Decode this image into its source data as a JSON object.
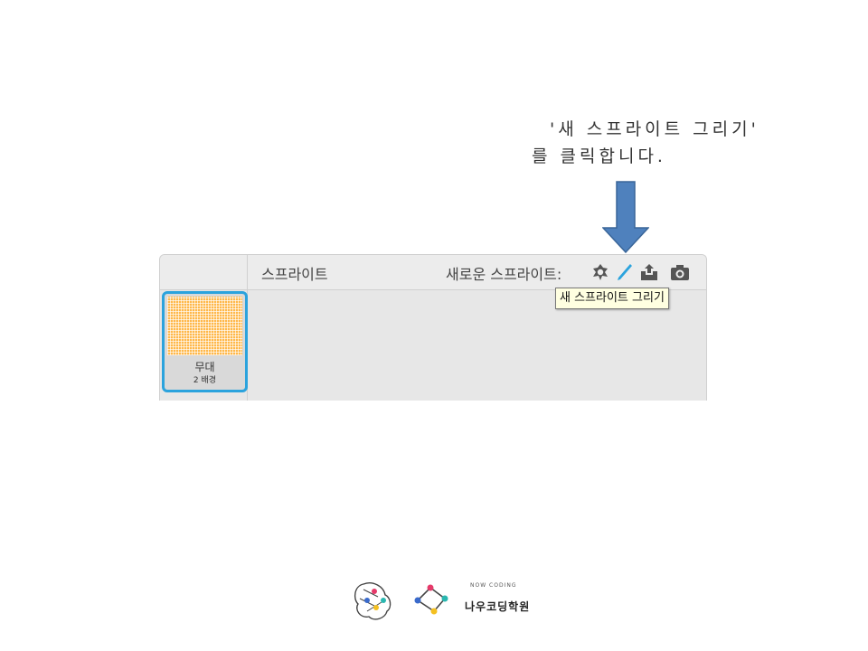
{
  "instruction": {
    "line1": "'새 스프라이트 그리기'",
    "line2": "를 클릭합니다."
  },
  "sprites_panel": {
    "title": "스프라이트",
    "new_sprite_label": "새로운 스프라이트:",
    "tools": [
      {
        "name": "choose-sprite-from-library-icon"
      },
      {
        "name": "paint-new-sprite-icon"
      },
      {
        "name": "upload-sprite-icon"
      },
      {
        "name": "camera-sprite-icon"
      }
    ],
    "tooltip": "새 스프라이트 그리기",
    "stage": {
      "name": "무대",
      "backdrops": "2 배경",
      "thumb_color": "#ffb84a",
      "selected_border": "#2ba3dd"
    }
  },
  "arrow_color": "#4f81bd",
  "logo": {
    "text": "나우코딩학원",
    "tagline": "NOW CODING"
  }
}
